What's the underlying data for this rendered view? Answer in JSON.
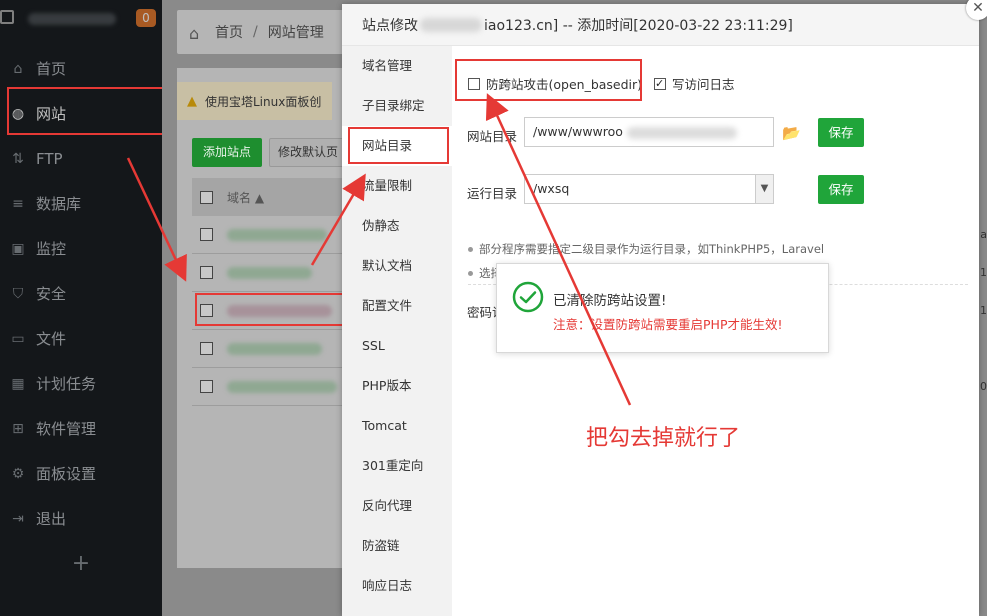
{
  "sidebar": {
    "badge": "0",
    "items": [
      {
        "label": "首页",
        "icon": "home-icon"
      },
      {
        "label": "网站",
        "icon": "globe-icon"
      },
      {
        "label": "FTP",
        "icon": "ftp-icon"
      },
      {
        "label": "数据库",
        "icon": "database-icon"
      },
      {
        "label": "监控",
        "icon": "monitor-icon"
      },
      {
        "label": "安全",
        "icon": "shield-icon"
      },
      {
        "label": "文件",
        "icon": "folder-icon"
      },
      {
        "label": "计划任务",
        "icon": "calendar-icon"
      },
      {
        "label": "软件管理",
        "icon": "grid-icon"
      },
      {
        "label": "面板设置",
        "icon": "gear-icon"
      },
      {
        "label": "退出",
        "icon": "logout-icon"
      }
    ],
    "add": "+"
  },
  "breadcrumb": {
    "home": "首页",
    "sep": "/",
    "current": "网站管理"
  },
  "background": {
    "warning": "使用宝塔Linux面板创",
    "add_site": "添加站点",
    "edit_default": "修改默认页",
    "col_domain": "域名 ▲",
    "edge_labels": [
      "a",
      "1",
      "1",
      "0"
    ]
  },
  "modal": {
    "title_prefix": "站点修改",
    "title_suffix": "iao123.cn] -- 添加时间[2020-03-22 23:11:29]",
    "close": "✕",
    "nav": [
      "域名管理",
      "子目录绑定",
      "网站目录",
      "流量限制",
      "伪静态",
      "默认文档",
      "配置文件",
      "SSL",
      "PHP版本",
      "Tomcat",
      "301重定向",
      "反向代理",
      "防盗链",
      "响应日志"
    ],
    "active_nav": "网站目录",
    "anti_xss_label": "防跨站攻击(open_basedir)",
    "anti_xss_checked": false,
    "access_log_label": "写访问日志",
    "access_log_checked": true,
    "site_dir_label": "网站目录",
    "site_dir_value": "/www/wwwroo",
    "run_dir_label": "运行目录",
    "run_dir_value": "/wxsq",
    "save": "保存",
    "tip1": "部分程序需要指定二级目录作为运行目录，如ThinkPHP5，Laravel",
    "tip2": "选择",
    "password_label": "密码访"
  },
  "toast": {
    "message": "已清除防跨站设置!",
    "note": "注意：设置防跨站需要重启PHP才能生效!"
  },
  "annotation": {
    "text": "把勾去掉就行了",
    "color": "#e53935"
  }
}
